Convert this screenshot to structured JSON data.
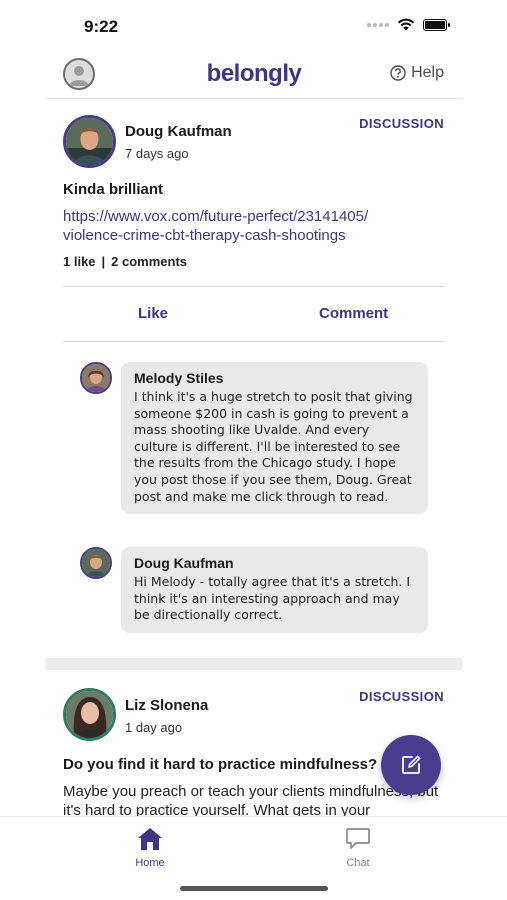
{
  "status_bar": {
    "time": "9:22"
  },
  "header": {
    "logo": "belongly",
    "help_label": "Help"
  },
  "posts": [
    {
      "author": "Doug Kaufman",
      "time_ago": "7 days ago",
      "type": "DISCUSSION",
      "title": "Kinda brilliant",
      "link": "https://www.vox.com/future-perfect/23141405/violence-crime-cbt-therapy-cash-shootings",
      "link_line1": "https://www.vox.com/future-perfect/23141405/",
      "link_line2": "violence-crime-cbt-therapy-cash-shootings",
      "likes": "1 like",
      "stats_separator": "|",
      "comments_count": "2 comments",
      "like_label": "Like",
      "comment_label": "Comment",
      "comments": [
        {
          "author": "Melody Stiles",
          "text": "I think it's a huge stretch to posit that giving someone $200 in cash is going to prevent a mass shooting like Uvalde.  And every culture is different. I'll be interested to see the results from the Chicago study. I hope you post those if you see them, Doug. Great post and make me click through to read."
        },
        {
          "author": "Doug Kaufman",
          "text": "Hi Melody - totally agree that it's a stretch. I think it's an interesting approach and may be directionally correct."
        }
      ]
    },
    {
      "author": "Liz Slonena",
      "time_ago": "1 day ago",
      "type": "DISCUSSION",
      "title": "Do you find it hard to practice mindfulness?",
      "body": "Maybe you preach or teach your clients mindfulness, but it's hard to practice yourself. What gets in your"
    }
  ],
  "tab_bar": {
    "tabs": [
      {
        "label": "Home",
        "icon": "home-icon",
        "active": true
      },
      {
        "label": "Chat",
        "icon": "chat-icon",
        "active": false
      }
    ]
  },
  "colors": {
    "brand": "#3d3685",
    "fab": "#4a3d8f",
    "bubble": "#e9e9ea"
  }
}
